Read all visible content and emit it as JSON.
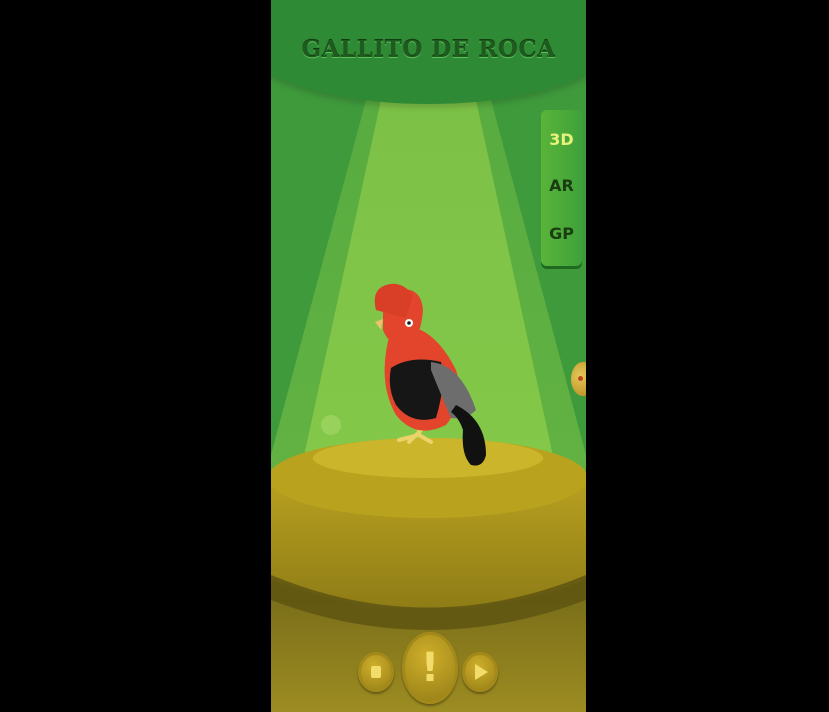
{
  "screen": {
    "title": "GALLITO DE ROCA"
  },
  "mode_panel": {
    "items": [
      {
        "label": "3D",
        "active": true
      },
      {
        "label": "AR",
        "active": false
      },
      {
        "label": "GP",
        "active": false
      }
    ]
  },
  "controls": {
    "stop_icon": "stop-icon",
    "info_label": "!",
    "play_icon": "play-icon"
  },
  "colors": {
    "background_green": "#3f9a3c",
    "header_green": "#2f8a35",
    "title_text": "#1f5b1f",
    "active_mode": "#e6f27a",
    "pedestal_gold": "#b3a21f",
    "bird_red": "#e2452c"
  },
  "scene": {
    "subject": "bird-3d-model",
    "subject_icon": "rooster-bird-icon"
  }
}
